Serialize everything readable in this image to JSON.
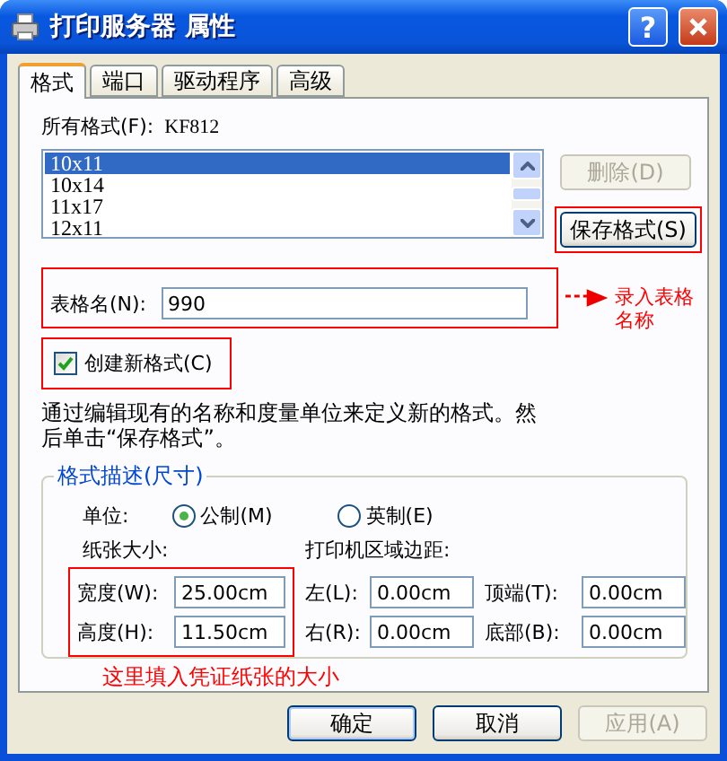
{
  "window": {
    "title": "打印服务器 属性"
  },
  "title_buttons": [
    {
      "kind": "help",
      "label": "?"
    },
    {
      "kind": "close"
    }
  ],
  "tabs": [
    {
      "label": "格式",
      "selected": true
    },
    {
      "label": "端口",
      "selected": false
    },
    {
      "label": "驱动程序",
      "selected": false
    },
    {
      "label": "高级",
      "selected": false
    }
  ],
  "forms_label": "所有格式(F):",
  "printer_name": "KF812",
  "forms": [
    {
      "label": "10x11",
      "selected": true
    },
    {
      "label": "10x14",
      "selected": false
    },
    {
      "label": "11x17",
      "selected": false
    },
    {
      "label": "12x11",
      "selected": false
    }
  ],
  "side_buttons": [
    {
      "label": "删除(D)",
      "disabled": true,
      "highlighted": false
    },
    {
      "label": "保存格式(S)",
      "disabled": false,
      "highlighted": true
    }
  ],
  "form_name": {
    "label": "表格名(N):",
    "value": "990",
    "highlighted": true
  },
  "note_name": "录入表格名称",
  "create_new": {
    "label": "创建新格式(C)",
    "checked": true,
    "highlighted": true
  },
  "description": "通过编辑现有的名称和度量单位来定义新的格式。然后单击“保存格式”。",
  "group": {
    "title": "格式描述(尺寸)",
    "units_label": "单位:",
    "units": [
      {
        "label": "公制(M)",
        "selected": true
      },
      {
        "label": "英制(E)",
        "selected": false
      }
    ],
    "paper_label": "纸张大小:",
    "margins_label": "打印机区域边距:",
    "paper": {
      "highlighted": true,
      "fields": [
        {
          "label": "宽度(W):",
          "value": "25.00cm"
        },
        {
          "label": "高度(H):",
          "value": "11.50cm"
        }
      ]
    },
    "margins": [
      [
        {
          "label": "左(L):",
          "value": "0.00cm"
        },
        {
          "label": "右(R):",
          "value": "0.00cm"
        }
      ],
      [
        {
          "label": "顶端(T):",
          "value": "0.00cm"
        },
        {
          "label": "底部(B):",
          "value": "0.00cm"
        }
      ]
    ]
  },
  "note_size": "这里填入凭证纸张的大小",
  "buttons": [
    {
      "label": "确定",
      "disabled": false,
      "default": true
    },
    {
      "label": "取消",
      "disabled": false,
      "default": false
    },
    {
      "label": "应用(A)",
      "disabled": true,
      "default": false
    }
  ]
}
